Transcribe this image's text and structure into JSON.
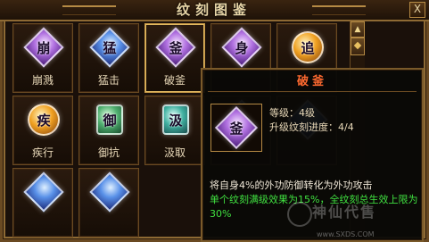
{
  "window": {
    "title": "纹刻图鉴",
    "close_label": "X"
  },
  "scrollbar": {
    "up_label": "▲"
  },
  "grid": {
    "cells": [
      {
        "label": "崩溅",
        "glyph": "崩",
        "color": "purple",
        "shape": "diamond"
      },
      {
        "label": "猛击",
        "glyph": "猛",
        "color": "blue",
        "shape": "diamond"
      },
      {
        "label": "破釜",
        "glyph": "釜",
        "color": "purple",
        "shape": "diamond"
      },
      {
        "label": "",
        "glyph": "身",
        "color": "purple",
        "shape": "diamond"
      },
      {
        "label": "",
        "glyph": "追",
        "color": "orange",
        "shape": "round"
      },
      {
        "label": "疾行",
        "glyph": "疾",
        "color": "orange",
        "shape": "round"
      },
      {
        "label": "御抗",
        "glyph": "御",
        "color": "green",
        "shape": "square"
      },
      {
        "label": "汲取",
        "glyph": "汲",
        "color": "teal",
        "shape": "square"
      },
      {
        "label": "",
        "glyph": "",
        "color": "blue",
        "shape": "diamond"
      },
      {
        "label": "",
        "glyph": "",
        "color": "blue",
        "shape": "diamond"
      },
      {
        "label": "",
        "glyph": "",
        "color": "blue",
        "shape": "diamond"
      },
      {
        "label": "",
        "glyph": "",
        "color": "blue",
        "shape": "diamond"
      }
    ]
  },
  "tooltip": {
    "title": "破釜",
    "icon_glyph": "釜",
    "level": "等级：4级",
    "progress": "升级纹刻进度：4/4",
    "desc_white": "将自身4%的外功防御转化为外功攻击",
    "desc_green": "单个纹刻满级效果为15%，全纹刻总生效上限为30%"
  },
  "watermark": {
    "text": "神仙代售",
    "url": "www.SXDS.COM"
  }
}
